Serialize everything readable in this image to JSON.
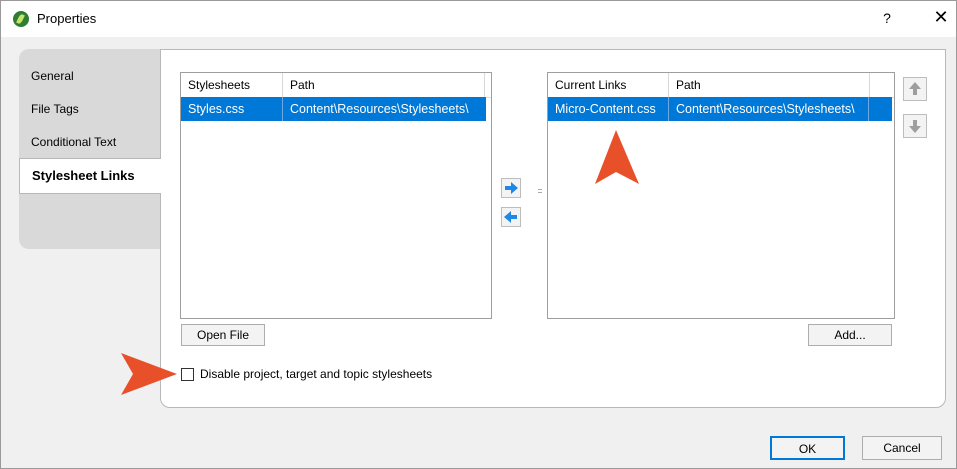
{
  "window": {
    "title": "Properties",
    "help_label": "?",
    "close_label": "✕"
  },
  "tabs": [
    {
      "label": "General"
    },
    {
      "label": "File Tags"
    },
    {
      "label": "Conditional Text"
    },
    {
      "label": "Stylesheet Links"
    }
  ],
  "left_list": {
    "columns": [
      "Stylesheets",
      "Path"
    ],
    "rows": [
      {
        "name": "Styles.css",
        "path": "Content\\Resources\\Stylesheets\\"
      }
    ]
  },
  "right_list": {
    "columns": [
      "Current Links",
      "Path"
    ],
    "rows": [
      {
        "name": "Micro-Content.css",
        "path": "Content\\Resources\\Stylesheets\\"
      }
    ]
  },
  "buttons": {
    "open_file": "Open File",
    "add": "Add...",
    "ok": "OK",
    "cancel": "Cancel"
  },
  "checkbox": {
    "label": "Disable project, target and topic stylesheets",
    "checked": false
  },
  "colors": {
    "selection": "#0078d7",
    "callout_arrow": "#e8502a",
    "move_arrow": "#1e88e5"
  }
}
